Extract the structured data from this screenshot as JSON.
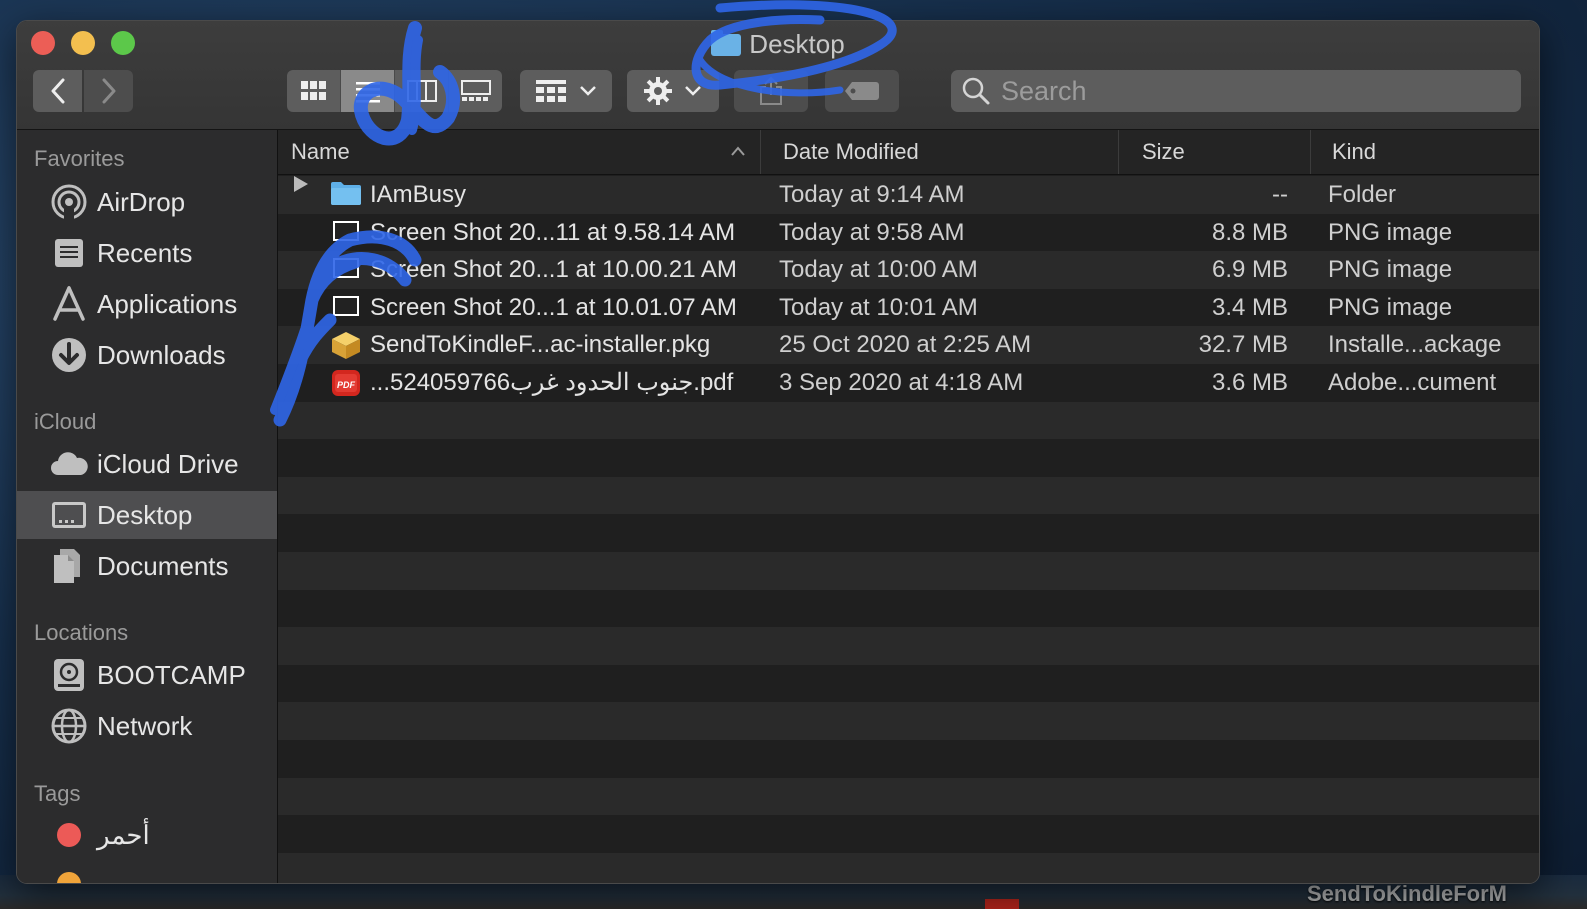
{
  "window": {
    "title": "Desktop",
    "title_icon": "folder-icon"
  },
  "toolbar": {
    "back": "back-icon",
    "forward": "forward-icon",
    "view_modes": [
      "icon-view-icon",
      "list-view-icon",
      "column-view-icon",
      "gallery-view-icon"
    ],
    "active_view": "list",
    "group_button": "group-icon",
    "action_button": "gear-icon",
    "share_button": "share-icon",
    "tag_button": "tag-icon",
    "search_placeholder": "Search"
  },
  "sidebar": {
    "sections": [
      {
        "title": "Favorites",
        "items": [
          {
            "label": "AirDrop",
            "icon": "airdrop-icon"
          },
          {
            "label": "Recents",
            "icon": "recents-icon"
          },
          {
            "label": "Applications",
            "icon": "applications-icon"
          },
          {
            "label": "Downloads",
            "icon": "downloads-icon"
          }
        ]
      },
      {
        "title": "iCloud",
        "items": [
          {
            "label": "iCloud Drive",
            "icon": "cloud-icon"
          },
          {
            "label": "Desktop",
            "icon": "desktop-icon",
            "selected": true
          },
          {
            "label": "Documents",
            "icon": "documents-icon"
          }
        ]
      },
      {
        "title": "Locations",
        "items": [
          {
            "label": "BOOTCAMP",
            "icon": "disk-icon"
          },
          {
            "label": "Network",
            "icon": "network-icon"
          }
        ]
      },
      {
        "title": "Tags",
        "items": [
          {
            "label": "أحمر",
            "icon": "tag-dot-icon",
            "color": "#ec5a57"
          }
        ]
      }
    ]
  },
  "columns": {
    "name": "Name",
    "date": "Date Modified",
    "size": "Size",
    "kind": "Kind",
    "sort": "ascending"
  },
  "files": [
    {
      "name": "IAmBusy",
      "date": "Today at 9:14 AM",
      "size": "--",
      "kind": "Folder",
      "icon": "folder-icon",
      "expandable": true
    },
    {
      "name": "Screen Shot 20...11 at 9.58.14 AM",
      "date": "Today at 9:58 AM",
      "size": "8.8 MB",
      "kind": "PNG image",
      "icon": "png-file-icon"
    },
    {
      "name": "Screen Shot 20...1 at 10.00.21 AM",
      "date": "Today at 10:00 AM",
      "size": "6.9 MB",
      "kind": "PNG image",
      "icon": "png-file-icon"
    },
    {
      "name": "Screen Shot 20...1 at 10.01.07 AM",
      "date": "Today at 10:01 AM",
      "size": "3.4 MB",
      "kind": "PNG image",
      "icon": "png-file-icon"
    },
    {
      "name": "SendToKindleF...ac-installer.pkg",
      "date": "25 Oct 2020 at 2:25 AM",
      "size": "32.7 MB",
      "kind": "Installe...ackage",
      "icon": "package-icon"
    },
    {
      "name": "...524059766جنوب الحدود غرب.pdf",
      "date": "3 Sep 2020 at 4:18 AM",
      "size": "3.6 MB",
      "kind": "Adobe...cument",
      "icon": "pdf-icon",
      "badge": "PDF"
    }
  ],
  "desktop_label": "SendToKindleForM",
  "colors": {
    "accent": "#3d6fe0",
    "scribble": "#2f66e8",
    "selection": "#4e4e50"
  }
}
